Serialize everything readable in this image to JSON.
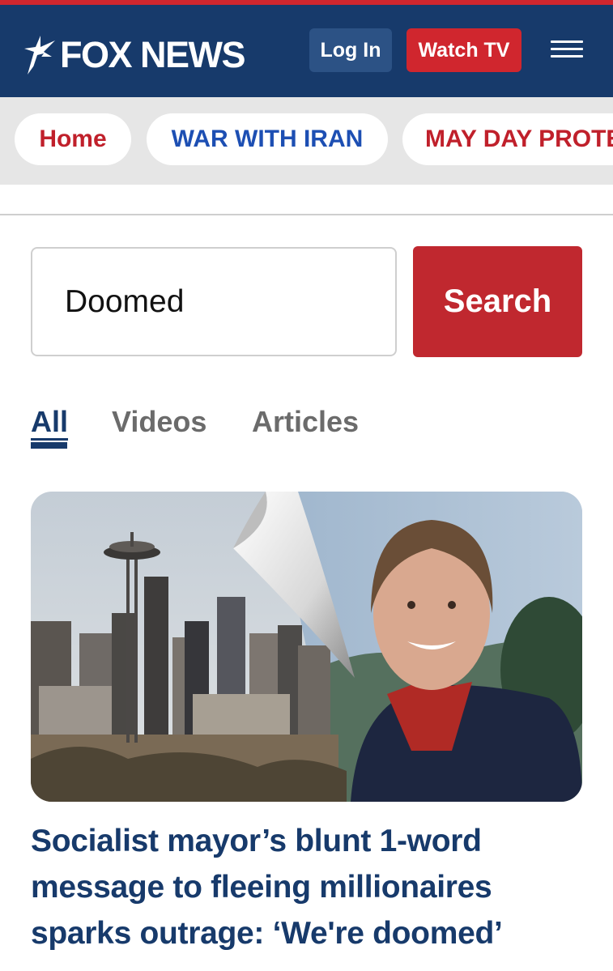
{
  "header": {
    "logo_text": "FOX NEWS",
    "login_label": "Log In",
    "watch_label": "Watch TV",
    "menu_icon": "hamburger-menu-icon"
  },
  "nav": {
    "items": [
      {
        "label": "Home",
        "color": "#c0202b"
      },
      {
        "label": "WAR WITH IRAN",
        "color": "#1d4fb3"
      },
      {
        "label": "MAY DAY PROTESTS",
        "color": "#c0202b"
      }
    ]
  },
  "search": {
    "value": "Doomed",
    "button_label": "Search"
  },
  "tabs": {
    "all": "All",
    "videos": "Videos",
    "articles": "Articles",
    "active": "All"
  },
  "article": {
    "headline": "Socialist mayor’s blunt 1-word message to fleeing millionaires sparks outrage: ‘We're doomed’"
  },
  "colors": {
    "brand_navy": "#173a6b",
    "brand_red": "#d0262e"
  }
}
